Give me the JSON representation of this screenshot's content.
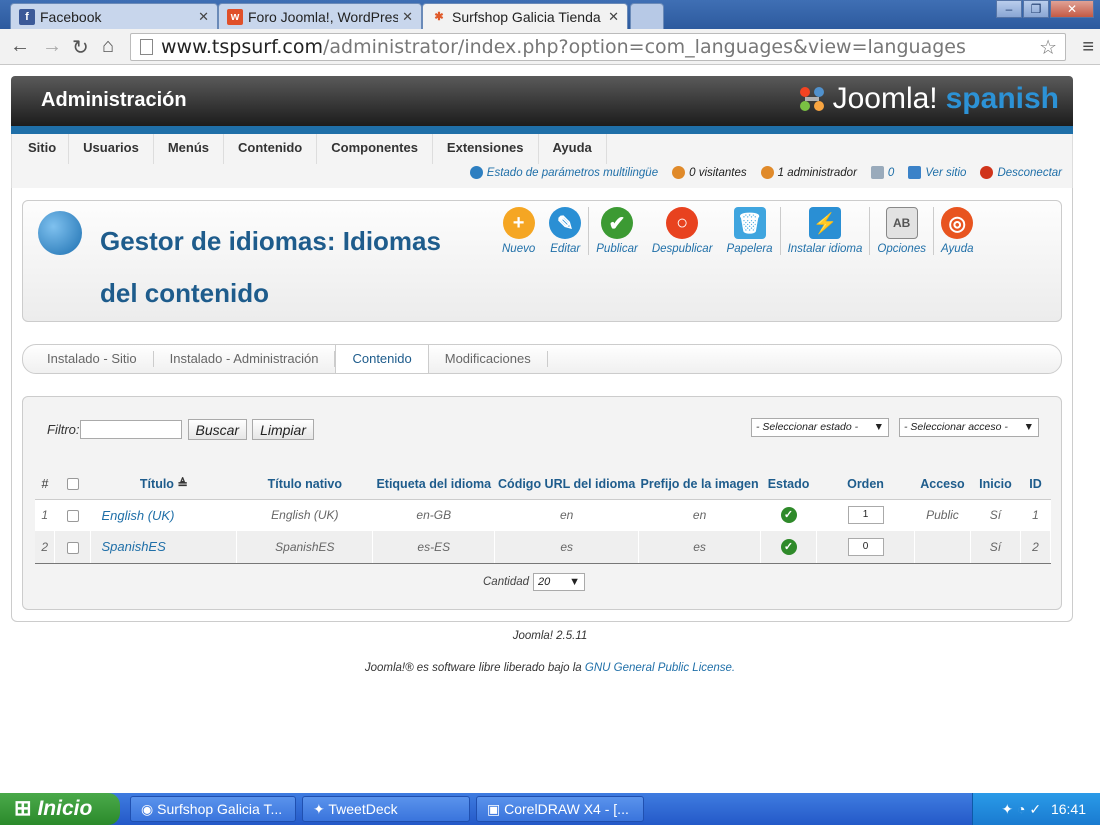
{
  "browser": {
    "tabs": [
      {
        "label": "Facebook",
        "icon": "facebook-icon"
      },
      {
        "label": "Foro Joomla!, WordPres",
        "icon": "forum-icon"
      },
      {
        "label": "Surfshop Galicia Tienda",
        "icon": "joomla-icon"
      }
    ],
    "url_host": "www.tspsurf.com",
    "url_path": "/administrator/index.php?option=com_languages&view=languages"
  },
  "header": {
    "title": "Administración",
    "logo_text": "Joomla!",
    "logo_sub": "spanish"
  },
  "menu": [
    "Sitio",
    "Usuarios",
    "Menús",
    "Contenido",
    "Componentes",
    "Extensiones",
    "Ayuda"
  ],
  "status": {
    "multilang": "Estado de parámetros multilingüe",
    "visitors": "0 visitantes",
    "admins": "1 administrador",
    "messages": "0",
    "view_site": "Ver sitio",
    "logout": "Desconectar"
  },
  "page": {
    "title": "Gestor de idiomas: Idiomas del contenido"
  },
  "toolbar": [
    {
      "label": "Nuevo",
      "icon": "plus-icon",
      "color": "#f5a623"
    },
    {
      "label": "Editar",
      "icon": "pencil-icon",
      "color": "#2a8fd4"
    },
    {
      "label": "Publicar",
      "icon": "check-icon",
      "color": "#3c9a33"
    },
    {
      "label": "Despublicar",
      "icon": "circle-icon",
      "color": "#e8421f"
    },
    {
      "label": "Papelera",
      "icon": "trash-icon",
      "color": "#3fa5df"
    },
    {
      "label": "Instalar idioma",
      "icon": "install-icon",
      "color": "#2a8fd4"
    },
    {
      "label": "Opciones",
      "icon": "options-icon",
      "color": "#888888"
    },
    {
      "label": "Ayuda",
      "icon": "lifebuoy-icon",
      "color": "#e8541f"
    }
  ],
  "subtabs": [
    "Instalado - Sitio",
    "Instalado - Administración",
    "Contenido",
    "Modificaciones"
  ],
  "filter": {
    "label": "Filtro:",
    "search_button": "Buscar",
    "clear_button": "Limpiar",
    "state_select": "- Seleccionar estado -",
    "access_select": "- Seleccionar acceso -"
  },
  "table": {
    "headers": [
      "#",
      "",
      "Título",
      "Título nativo",
      "Etiqueta del idioma",
      "Código URL del idioma",
      "Prefijo de la imagen",
      "Estado",
      "Orden",
      "Acceso",
      "Inicio",
      "ID"
    ],
    "rows": [
      {
        "num": "1",
        "title": "English (UK)",
        "native": "English (UK)",
        "tag": "en-GB",
        "code": "en",
        "image": "en",
        "order": "1",
        "access": "Public",
        "home": "Sí",
        "id": "1"
      },
      {
        "num": "2",
        "title": "SpanishES",
        "native": "SpanishES",
        "tag": "es-ES",
        "code": "es",
        "image": "es",
        "order": "0",
        "access": "",
        "home": "Sí",
        "id": "2"
      }
    ]
  },
  "pagination": {
    "label": "Cantidad",
    "value": "20"
  },
  "footer": {
    "version": "Joomla! 2.5.11",
    "license_prefix": "Joomla!® es software libre liberado bajo la",
    "license_link": "GNU General Public License."
  },
  "taskbar": {
    "start": "Inicio",
    "items": [
      "Surfshop Galicia T...",
      "TweetDeck",
      "CorelDRAW X4 - [..."
    ],
    "clock": "16:41"
  }
}
